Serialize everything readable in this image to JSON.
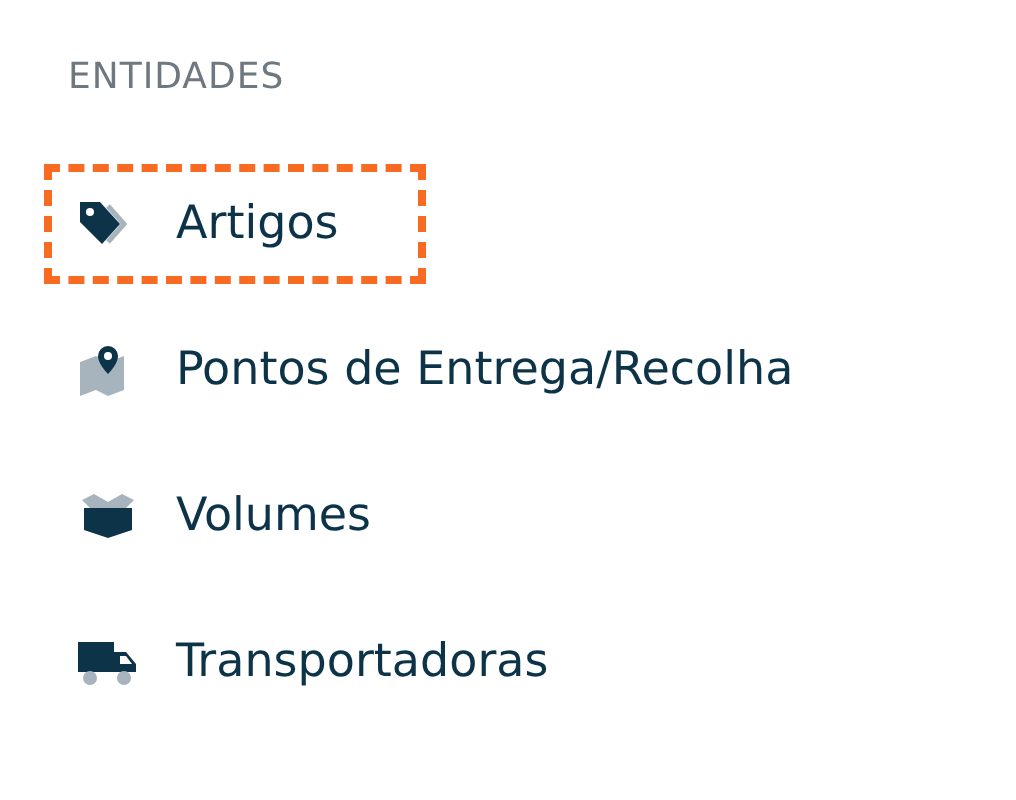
{
  "section": {
    "title": "ENTIDADES",
    "items": [
      {
        "label": "Artigos",
        "kind": "tag",
        "selected": true
      },
      {
        "label": "Pontos de Entrega/Recolha",
        "kind": "map",
        "selected": false
      },
      {
        "label": "Volumes",
        "kind": "box",
        "selected": false
      },
      {
        "label": "Transportadoras",
        "kind": "truck",
        "selected": false
      }
    ]
  }
}
